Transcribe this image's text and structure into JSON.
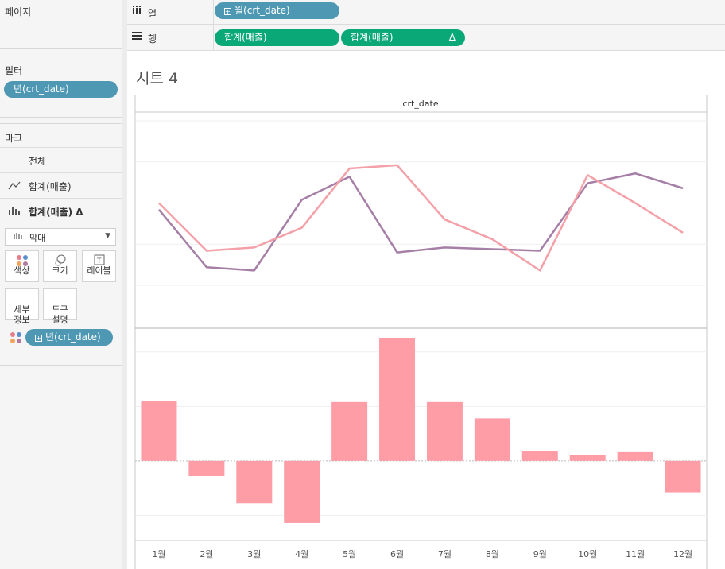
{
  "pages_label": "페이지",
  "filters": {
    "title": "필터",
    "pill": "년(crt_date)"
  },
  "marks": {
    "title": "마크",
    "rows": [
      {
        "icon": "",
        "label": "전체"
      },
      {
        "icon": "line-chart-icon",
        "label": "합계(매출)"
      },
      {
        "icon": "bar-chart-icon",
        "label": "합계(매출) Δ"
      }
    ],
    "mark_type": "막대",
    "buttons": [
      "색상",
      "크기",
      "레이블",
      "세부\n정보",
      "도구\n설명"
    ],
    "color_pill": "년(crt_date)"
  },
  "shelves": {
    "columns": {
      "label": "열",
      "pill": "월(crt_date)"
    },
    "rows": {
      "label": "행",
      "pills": [
        "합계(매출)",
        "합계(매출)"
      ],
      "delta": "Δ"
    }
  },
  "sheet": {
    "title": "시트 4",
    "header": "crt_date"
  },
  "colors": {
    "pink": "#f4a0a8",
    "purple": "#a67fa6",
    "bar": "#ff9da7",
    "blue_pill": "#4e98b3",
    "green_pill": "#0aa877"
  },
  "chart_data": {
    "type": "line+bar",
    "categories": [
      "1월",
      "2월",
      "3월",
      "4월",
      "5월",
      "6월",
      "7월",
      "8월",
      "9월",
      "10월",
      "11월",
      "12월"
    ],
    "line_series": [
      {
        "values": [
          46,
          11,
          9,
          52,
          66,
          20,
          23,
          22,
          21,
          62,
          68,
          59
        ]
      },
      {
        "values": [
          50,
          21,
          23,
          35,
          71,
          73,
          40,
          28,
          9,
          67,
          50,
          32
        ]
      }
    ],
    "line_ylim": [
      0,
      100
    ],
    "bar_values": [
      55,
      -14,
      -39,
      -57,
      54,
      113,
      54,
      39,
      9,
      5,
      8,
      -29
    ],
    "bar_ylim": [
      -68,
      113
    ]
  }
}
